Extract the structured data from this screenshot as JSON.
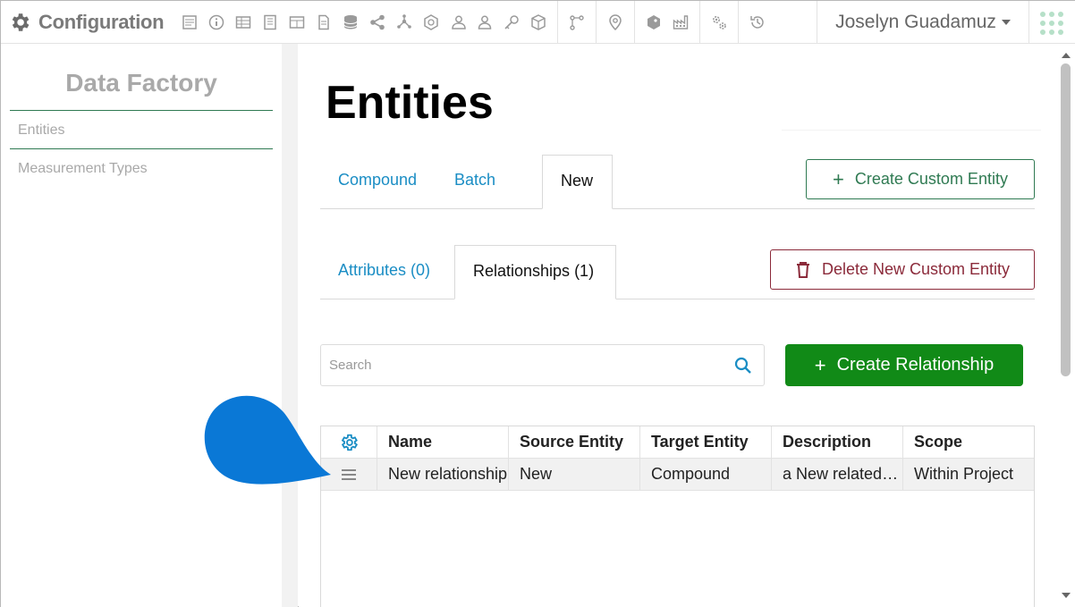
{
  "app": {
    "title": "Configuration",
    "user_name": "Joselyn Guadamuz"
  },
  "toolbar_icons": [
    "form-icon",
    "info-icon",
    "table-icon",
    "book-icon",
    "grid-table-icon",
    "document-icon",
    "database-icon",
    "share-icon",
    "network-icon",
    "compound-icon",
    "user-group-icon",
    "user-icon",
    "key-icon",
    "cube-icon",
    "workflow-icon",
    "location-icon",
    "tag-icon",
    "factory-icon",
    "settings-gears-icon",
    "history-icon"
  ],
  "sidebar": {
    "title": "Data Factory",
    "items": [
      {
        "label": "Entities"
      },
      {
        "label": "Measurement Types"
      }
    ]
  },
  "main": {
    "page_title": "Entities",
    "entity_tabs": [
      {
        "label": "Compound"
      },
      {
        "label": "Batch"
      },
      {
        "label": "New"
      }
    ],
    "create_custom_entity_label": "Create Custom Entity",
    "sub_tabs": [
      {
        "label": "Attributes (0)"
      },
      {
        "label": "Relationships (1)"
      }
    ],
    "delete_custom_entity_label": "Delete New Custom Entity",
    "search": {
      "placeholder": "Search",
      "value": ""
    },
    "create_relationship_label": "Create Relationship",
    "table": {
      "columns": [
        "Name",
        "Source Entity",
        "Target Entity",
        "Description",
        "Scope"
      ],
      "rows": [
        {
          "name": "New relationship",
          "source": "New",
          "target": "Compound",
          "description": "a New related to a Compound",
          "scope": "Within Project"
        }
      ]
    }
  },
  "colors": {
    "accent_blue": "#1a8dc4",
    "primary_green": "#118a17",
    "outline_green": "#2f7a52",
    "danger_red": "#8b2a3a",
    "cursor_blue": "#0a78d6"
  }
}
